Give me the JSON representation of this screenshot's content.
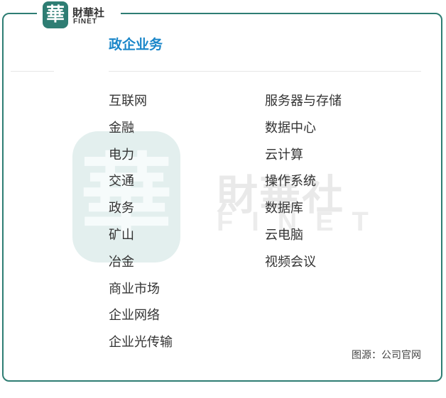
{
  "brand": {
    "mark": "華",
    "name_cn": "財華社",
    "name_en": "FINET"
  },
  "title": "政企业务",
  "left_column": [
    "互联网",
    "金融",
    "电力",
    "交通",
    "政务",
    "矿山",
    "冶金",
    "商业市场",
    "企业网络",
    "企业光传输"
  ],
  "right_column": [
    "服务器与存储",
    "数据中心",
    "云计算",
    "操作系统",
    "数据库",
    "云电脑",
    "视频会议"
  ],
  "source": "图源：公司官网",
  "colors": {
    "frame": "#2e7d73",
    "title": "#1a86c9",
    "text": "#333333"
  }
}
